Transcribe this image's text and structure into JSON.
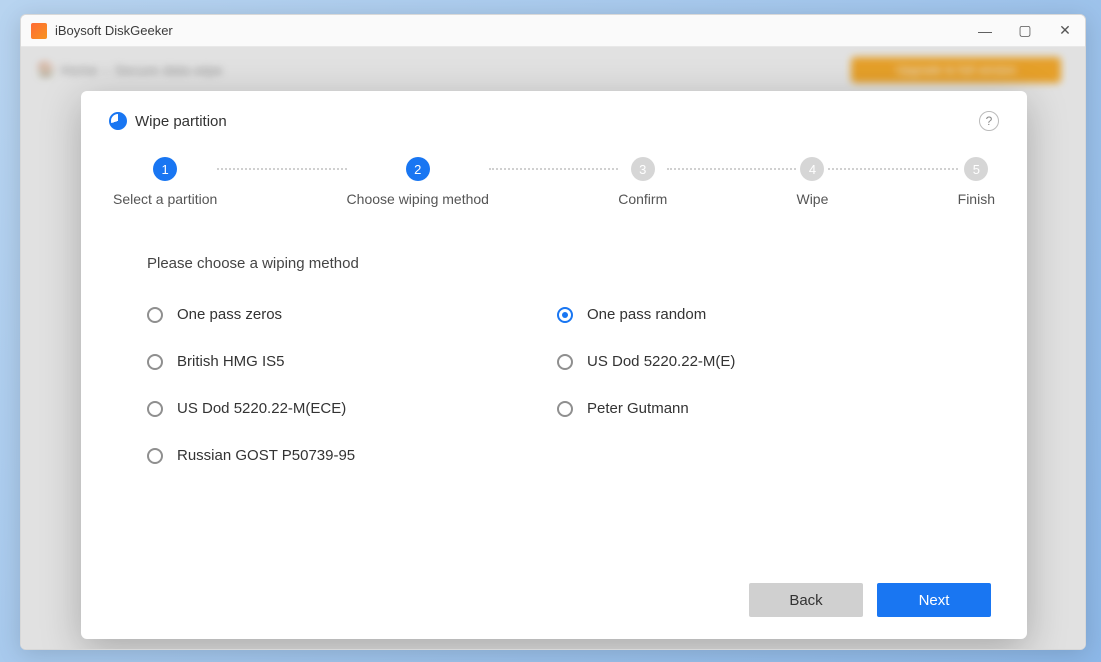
{
  "app": {
    "title": "iBoysoft DiskGeeker"
  },
  "background": {
    "breadcrumb_home": "Home",
    "breadcrumb_page": "Secure data wipe",
    "upgrade_label": "Upgrade to full version"
  },
  "modal": {
    "title": "Wipe partition",
    "help": "?",
    "prompt": "Please choose a wiping method",
    "back_label": "Back",
    "next_label": "Next"
  },
  "steps": [
    {
      "num": "1",
      "label": "Select a partition",
      "state": "active"
    },
    {
      "num": "2",
      "label": "Choose wiping method",
      "state": "active"
    },
    {
      "num": "3",
      "label": "Confirm",
      "state": "inactive"
    },
    {
      "num": "4",
      "label": "Wipe",
      "state": "inactive"
    },
    {
      "num": "5",
      "label": "Finish",
      "state": "inactive"
    }
  ],
  "options": {
    "col1": [
      {
        "id": "one-pass-zeros",
        "label": "One pass zeros",
        "selected": false
      },
      {
        "id": "british-hmg",
        "label": "British HMG IS5",
        "selected": false
      },
      {
        "id": "us-dod-ece",
        "label": "US Dod 5220.22-M(ECE)",
        "selected": false
      },
      {
        "id": "russian-gost",
        "label": "Russian GOST P50739-95",
        "selected": false
      }
    ],
    "col2": [
      {
        "id": "one-pass-random",
        "label": "One pass random",
        "selected": true
      },
      {
        "id": "us-dod-e",
        "label": "US Dod 5220.22-M(E)",
        "selected": false
      },
      {
        "id": "peter-gutmann",
        "label": "Peter Gutmann",
        "selected": false
      }
    ]
  }
}
